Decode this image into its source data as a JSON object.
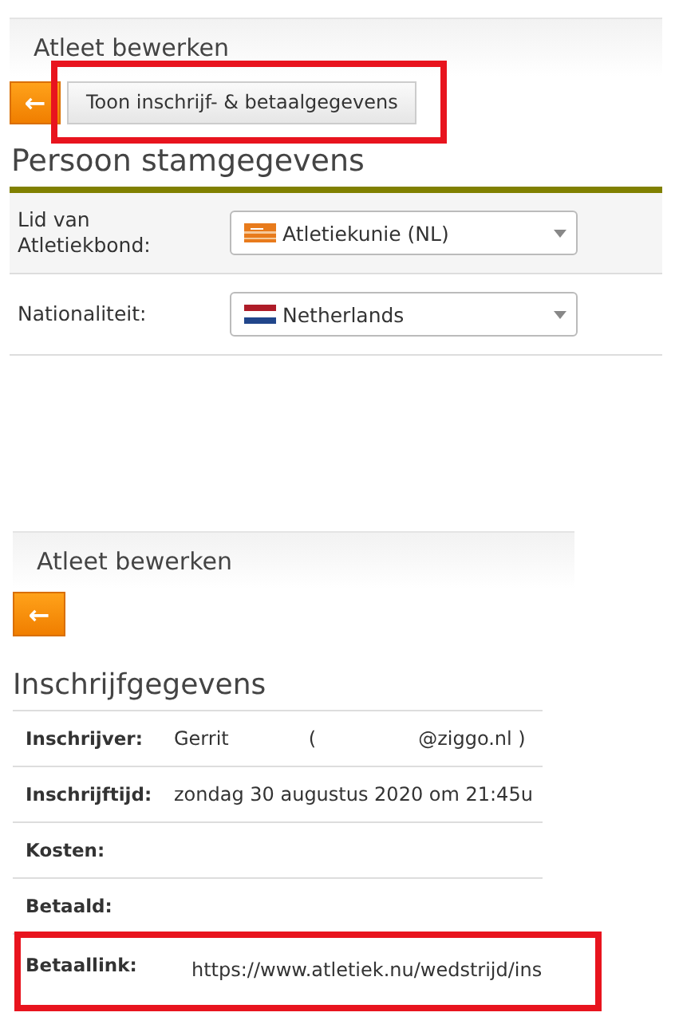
{
  "top": {
    "title": "Atleet bewerken",
    "back_button": {
      "icon": "←"
    },
    "show_button": {
      "label": "Toon inschrijf- & betaalgegevens",
      "highlighted": true
    },
    "heading": "Persoon stamgegevens",
    "fields": [
      {
        "label": "Lid van Atletiekbond:",
        "value": "Atletiekunie (NL)",
        "kind": "club"
      },
      {
        "label": "Nationaliteit:",
        "value": "Netherlands",
        "kind": "nl"
      }
    ]
  },
  "bottom": {
    "title": "Atleet bewerken",
    "back_button": {
      "icon": "←"
    },
    "heading": "Inschrijfgegevens",
    "rows": [
      {
        "label": "Inschrijver:",
        "values": [
          "Gerrit",
          "(",
          "@ziggo.nl )"
        ],
        "highlighted": false
      },
      {
        "label": "Inschrijftijd:",
        "values": [
          "zondag 30 augustus 2020 om 21:45u"
        ],
        "highlighted": false
      },
      {
        "label": "Kosten:",
        "values": [],
        "highlighted": false
      },
      {
        "label": "Betaald:",
        "values": [],
        "highlighted": false
      },
      {
        "label": "Betaallink:",
        "values": [
          "https://www.atletiek.nu/wedstrijd/ins"
        ],
        "highlighted": true
      }
    ]
  }
}
